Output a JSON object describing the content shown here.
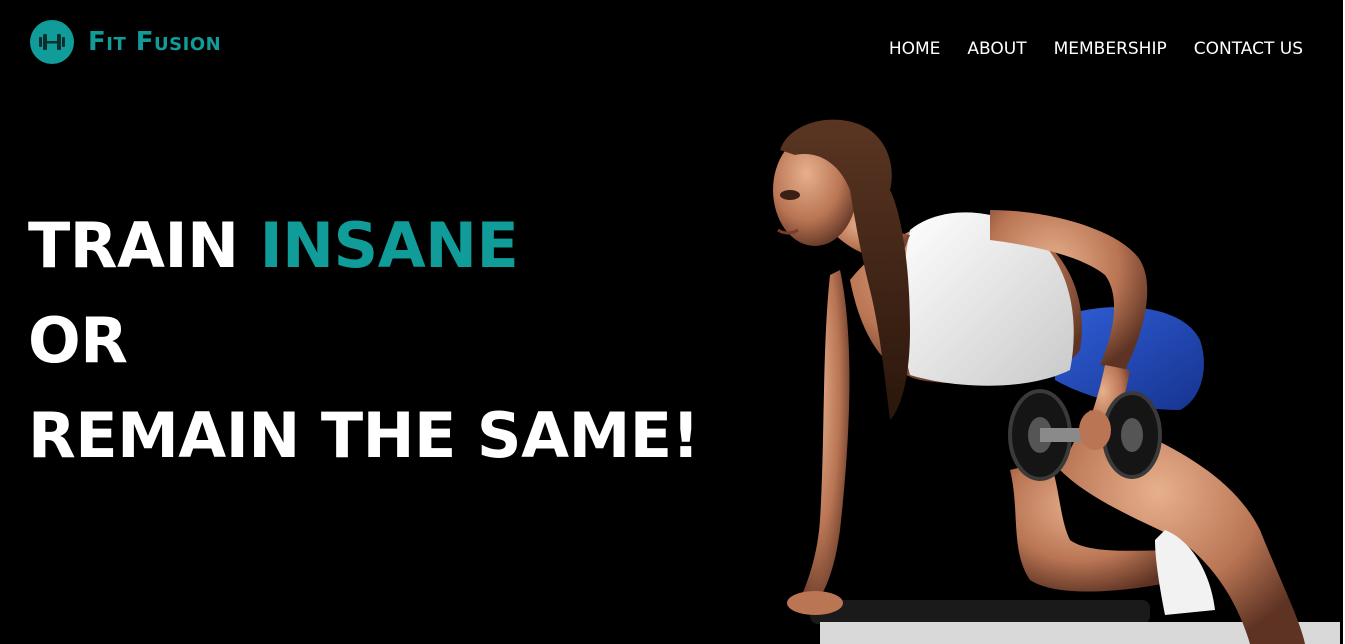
{
  "brand": {
    "name": "Fit Fusion",
    "accent_color": "#109c98",
    "logo_icon": "dumbbell-icon"
  },
  "nav": {
    "items": [
      {
        "label": "HOME"
      },
      {
        "label": "ABOUT"
      },
      {
        "label": "MEMBERSHIP"
      },
      {
        "label": "CONTACT US"
      }
    ]
  },
  "hero": {
    "line1_word1": "TRAIN",
    "line1_word2": "INSANE",
    "line2": "OR",
    "line3": "REMAIN THE SAME!"
  },
  "colors": {
    "background": "#000000",
    "text": "#ffffff",
    "accent": "#109c98"
  }
}
